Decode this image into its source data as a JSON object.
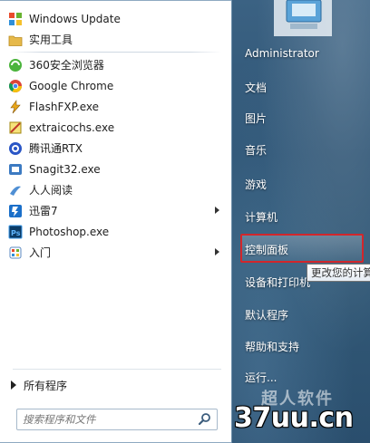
{
  "programs": [
    {
      "label": "Windows Update",
      "icon": "windows-update-icon"
    },
    {
      "label": "实用工具",
      "icon": "folder-icon"
    },
    {
      "label": "360安全浏览器",
      "icon": "360-browser-icon"
    },
    {
      "label": "Google Chrome",
      "icon": "chrome-icon"
    },
    {
      "label": "FlashFXP.exe",
      "icon": "flashfxp-icon"
    },
    {
      "label": "extraicochs.exe",
      "icon": "extraico-icon"
    },
    {
      "label": "腾讯通RTX",
      "icon": "rtx-icon"
    },
    {
      "label": "Snagit32.exe",
      "icon": "snagit-icon"
    },
    {
      "label": "人人阅读",
      "icon": "renren-reader-icon"
    },
    {
      "label": "迅雷7",
      "icon": "thunder-icon",
      "has_submenu": true
    },
    {
      "label": "Photoshop.exe",
      "icon": "photoshop-icon"
    },
    {
      "label": "入门",
      "icon": "getting-started-icon",
      "has_submenu": true
    }
  ],
  "all_programs_label": "所有程序",
  "search": {
    "placeholder": "搜索程序和文件"
  },
  "right_menu": [
    {
      "label": "Administrator"
    },
    {
      "label": "文档"
    },
    {
      "label": "图片"
    },
    {
      "label": "音乐"
    },
    {
      "label": "游戏"
    },
    {
      "label": "计算机"
    },
    {
      "label": "控制面板"
    },
    {
      "label": "设备和打印机"
    },
    {
      "label": "默认程序"
    },
    {
      "label": "帮助和支持"
    },
    {
      "label": "运行..."
    }
  ],
  "tooltip": "更改您的计算",
  "watermark": {
    "site": "37uu.cn",
    "brand": "超人软件"
  },
  "colors": {
    "highlight_border": "#d2262b",
    "panel_bg": "#2f5575"
  }
}
